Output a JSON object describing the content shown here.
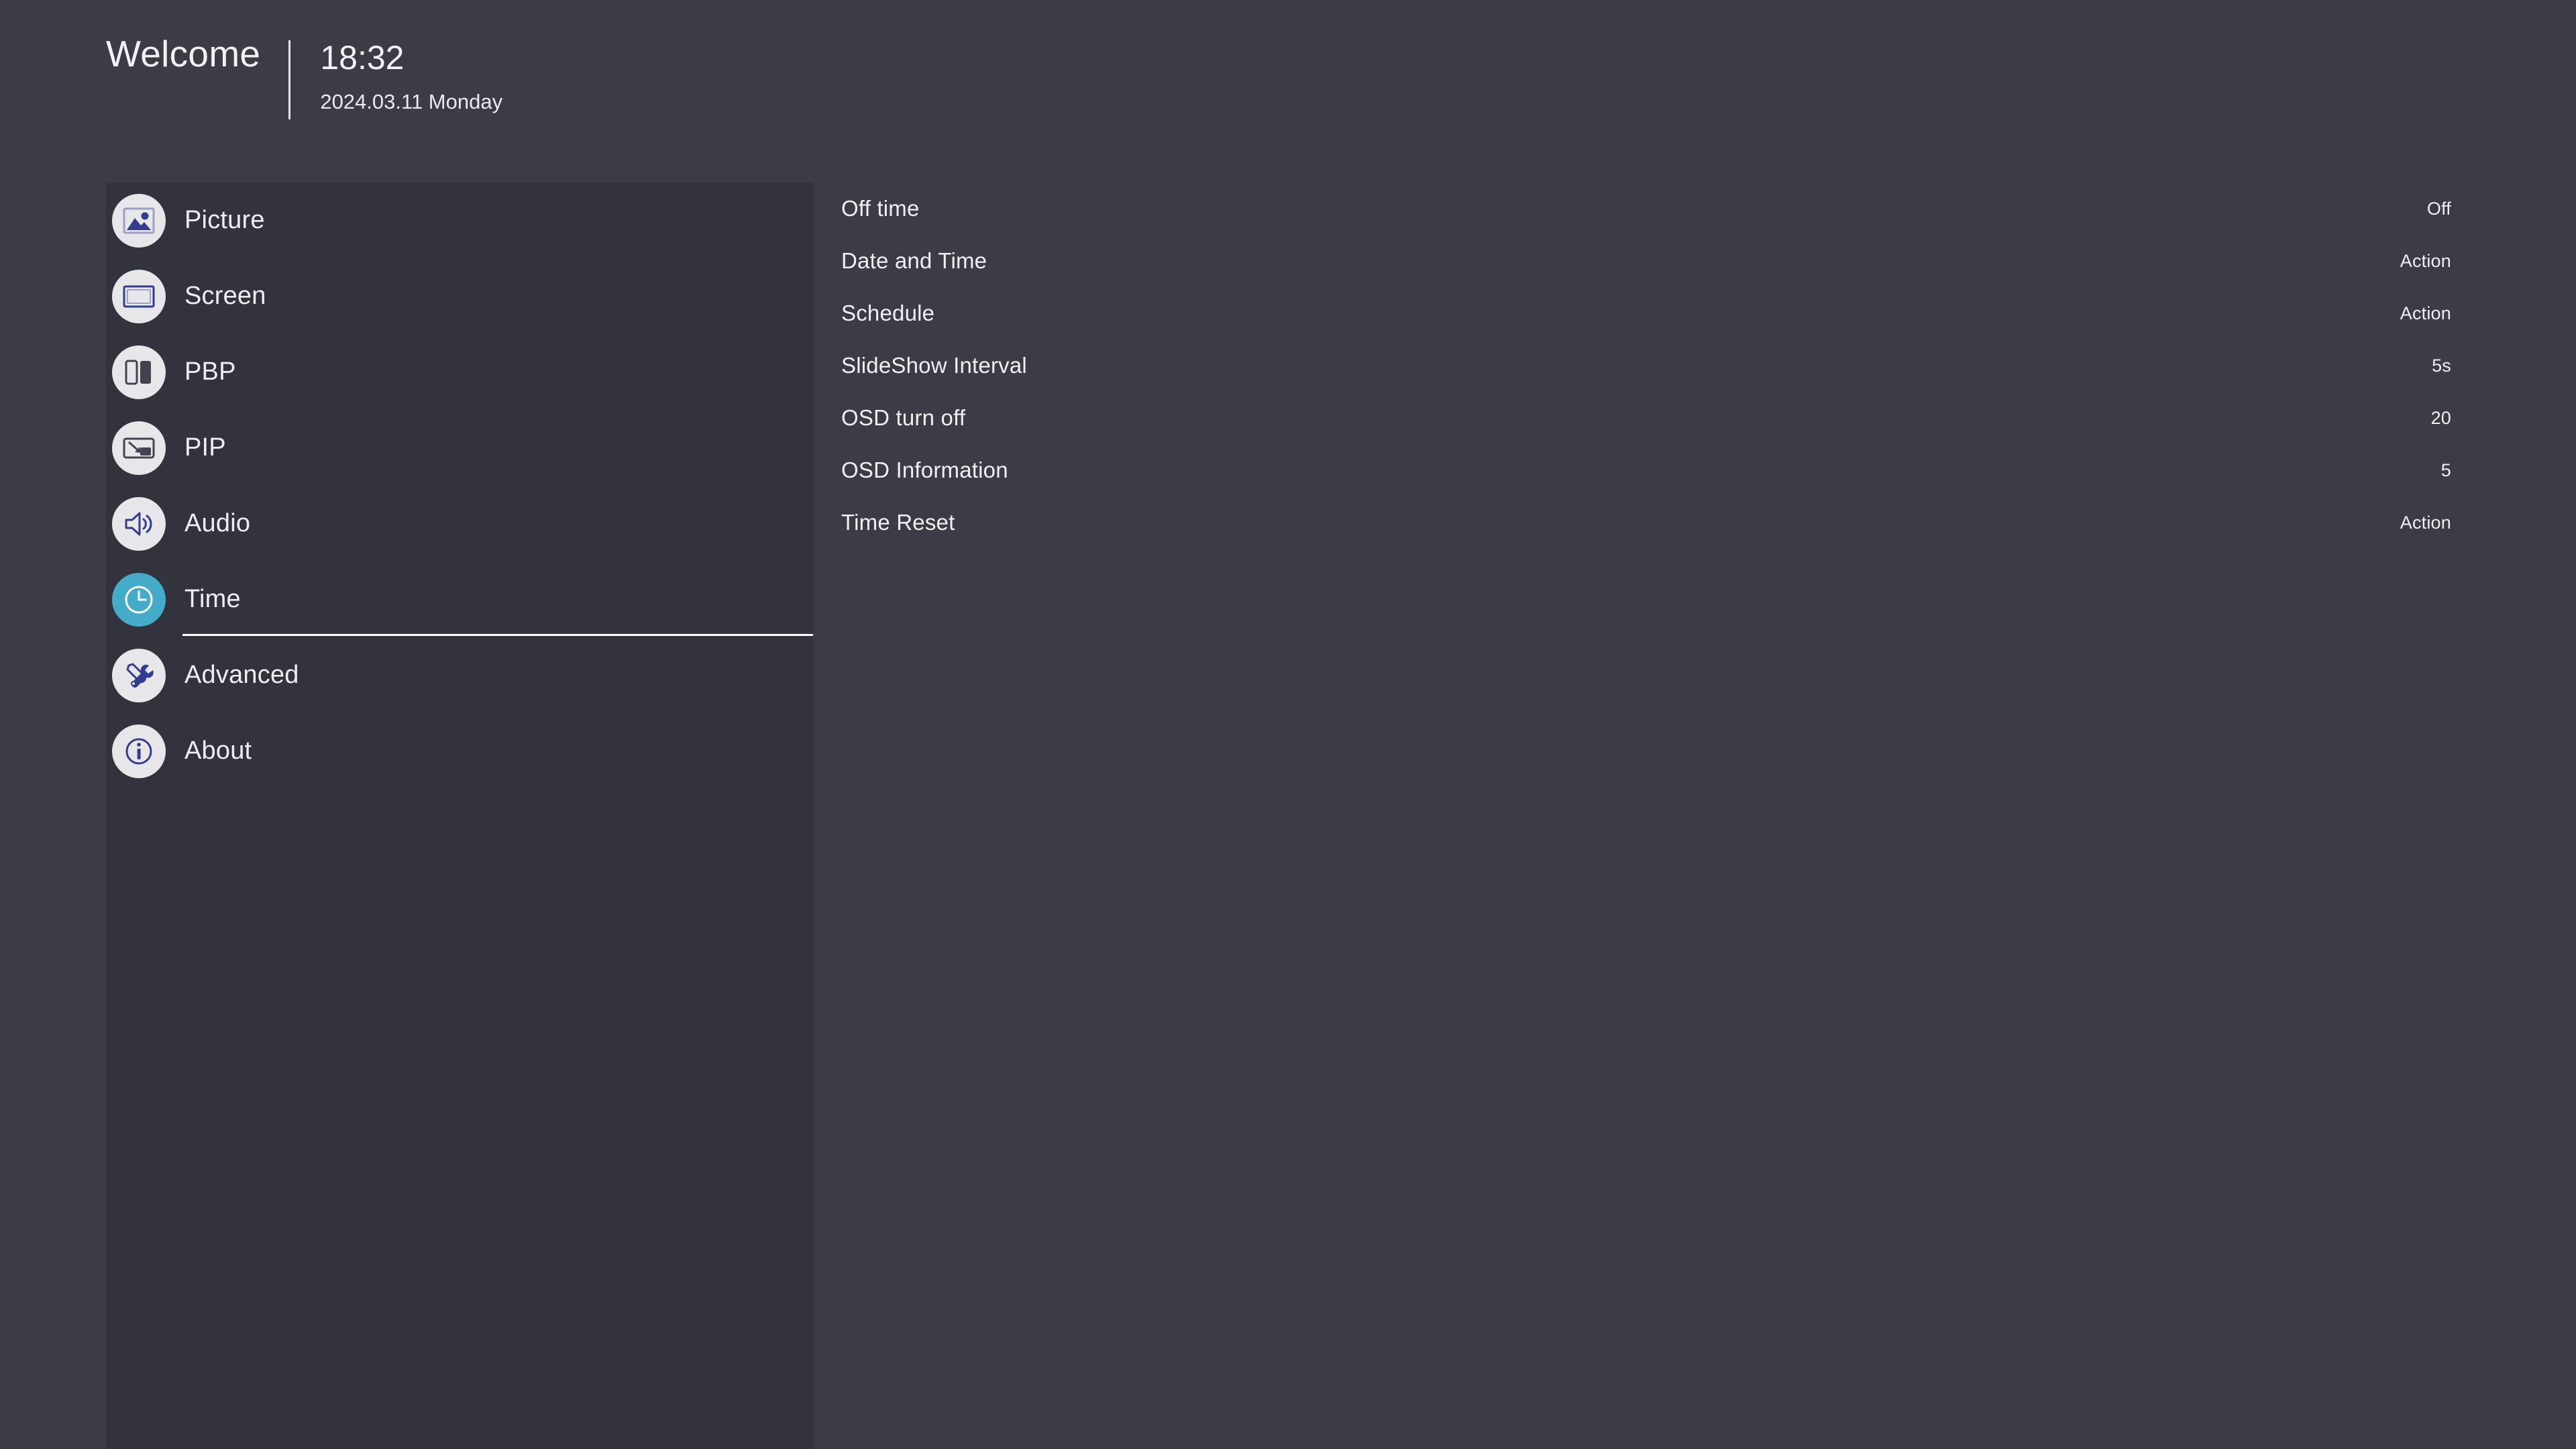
{
  "header": {
    "welcome": "Welcome",
    "time": "18:32",
    "date": "2024.03.11 Monday"
  },
  "colors": {
    "page_background": "#3c3c46",
    "panel_background": "#33333d",
    "icon_circle": "#e7e7e9",
    "icon_glyph_blue": "#333d8f",
    "icon_glyph_dark": "#434350",
    "accent_selected": "#44abc8",
    "text_primary": "#f0f0f3",
    "underline": "#ffffff"
  },
  "sidebar": {
    "items": [
      {
        "label": "Picture",
        "icon": "picture-icon",
        "selected": false
      },
      {
        "label": "Screen",
        "icon": "screen-icon",
        "selected": false
      },
      {
        "label": "PBP",
        "icon": "pbp-icon",
        "selected": false
      },
      {
        "label": "PIP",
        "icon": "pip-icon",
        "selected": false
      },
      {
        "label": "Audio",
        "icon": "audio-icon",
        "selected": false
      },
      {
        "label": "Time",
        "icon": "clock-icon",
        "selected": true
      },
      {
        "label": "Advanced",
        "icon": "tools-icon",
        "selected": false
      },
      {
        "label": "About",
        "icon": "info-icon",
        "selected": false
      }
    ]
  },
  "settings": {
    "rows": [
      {
        "label": "Off time",
        "value": "Off"
      },
      {
        "label": "Date and Time",
        "value": "Action"
      },
      {
        "label": "Schedule",
        "value": "Action"
      },
      {
        "label": "SlideShow Interval",
        "value": "5s"
      },
      {
        "label": "OSD turn off",
        "value": "20"
      },
      {
        "label": "OSD Information",
        "value": "5"
      },
      {
        "label": "Time Reset",
        "value": "Action"
      }
    ]
  }
}
